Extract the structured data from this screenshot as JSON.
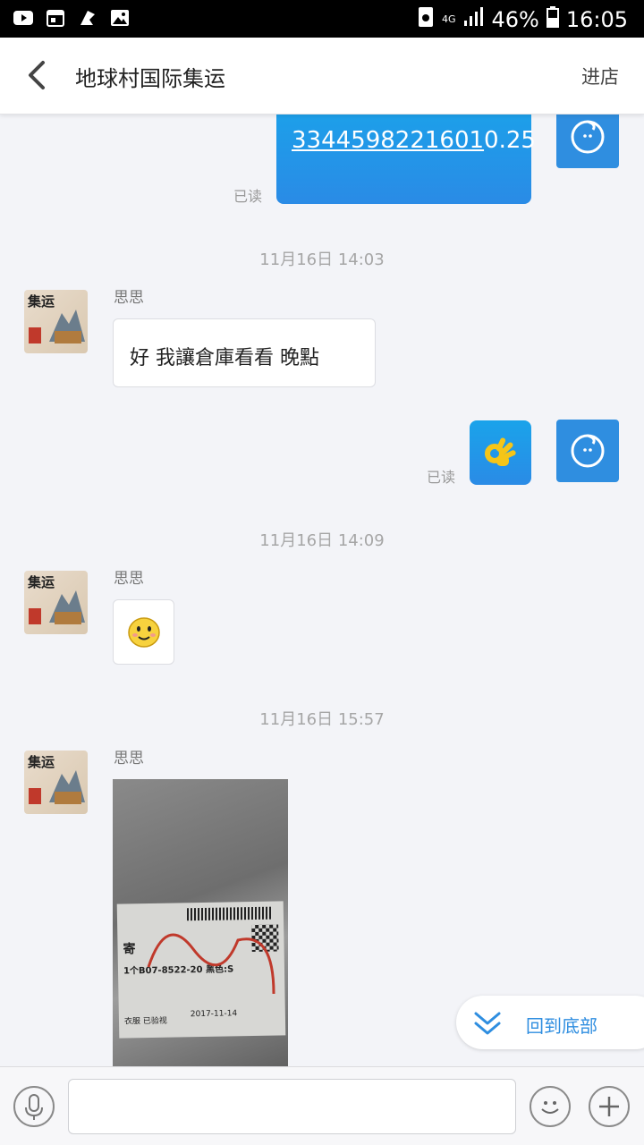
{
  "status_bar": {
    "network": "4G",
    "battery": "46%",
    "time": "16:05"
  },
  "header": {
    "title": "地球村国际集运",
    "store_label": "进店"
  },
  "messages": {
    "m1": {
      "number_linked": "3344598221601",
      "number_rest": "0.25",
      "read": "已读"
    },
    "t1": "11月16日 14:03",
    "m2": {
      "sender": "思思",
      "text": "好 我讓倉庫看看 晚點"
    },
    "m3": {
      "read": "已读"
    },
    "t2": "11月16日 14:09",
    "m4": {
      "sender": "思思"
    },
    "t3": "11月16日 15:57",
    "m5": {
      "sender": "思思",
      "label_lines": [
        "寄",
        "1个B07-8522-20 黑色:S",
        "衣服  已验视",
        "2017-11-14"
      ]
    }
  },
  "shop_avatar_text": "集运",
  "back_to_bottom": "回到底部",
  "colors": {
    "accent": "#2f8ee0",
    "bubble_blue": "#1aa3ea",
    "background": "#f3f4f8"
  },
  "input": {
    "value": ""
  }
}
